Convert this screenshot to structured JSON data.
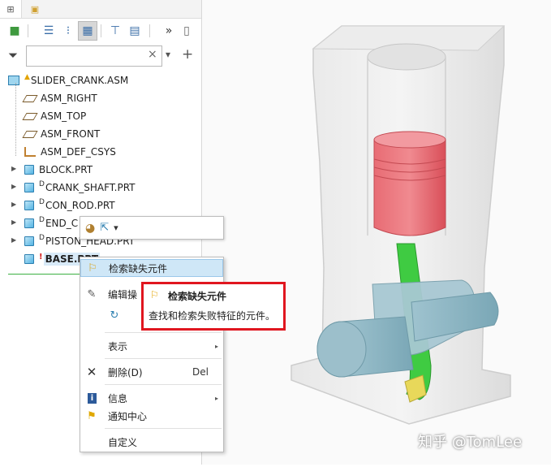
{
  "tabs": [
    {
      "icon": "model-tree-icon"
    },
    {
      "icon": "folder-browser-icon"
    }
  ],
  "toolbar": {
    "buttons": [
      "settings-icon",
      "tree-list-icon",
      "tree-filter-icon",
      "columns-icon",
      "show-icon",
      "layers-icon",
      "more-icon",
      "notes-icon"
    ]
  },
  "filter": {
    "value": "",
    "placeholder": "",
    "clear": "×",
    "dropdown": "▾",
    "add": "+"
  },
  "tree": {
    "items": [
      {
        "label": "SLIDER_CRANK.ASM",
        "icon": "assembly-icon",
        "mark": "▲"
      },
      {
        "label": "ASM_RIGHT",
        "icon": "datum-plane-icon"
      },
      {
        "label": "ASM_TOP",
        "icon": "datum-plane-icon"
      },
      {
        "label": "ASM_FRONT",
        "icon": "datum-plane-icon"
      },
      {
        "label": "ASM_DEF_CSYS",
        "icon": "csys-icon"
      },
      {
        "label": "BLOCK.PRT",
        "icon": "part-icon"
      },
      {
        "label": "CRANK_SHAFT.PRT",
        "icon": "part-icon",
        "mark": "D"
      },
      {
        "label": "CON_ROD.PRT",
        "icon": "part-icon",
        "mark": "D"
      },
      {
        "label": "END_C",
        "icon": "part-icon",
        "mark": "D"
      },
      {
        "label": "PISTON_HEAD.PRT",
        "icon": "part-icon",
        "mark": "D"
      },
      {
        "label": "BASE.PRT",
        "icon": "part-icon",
        "mark": "!"
      }
    ]
  },
  "minibar": {
    "icons": [
      "appearance-icon",
      "component-op-icon"
    ],
    "arrow": "▾"
  },
  "context_menu": {
    "items": [
      {
        "label": "检索缺失元件",
        "icon": "retrieve-icon",
        "hover": true
      },
      {
        "label": "编辑操",
        "icon": "pencil-icon"
      },
      {
        "label": "",
        "icon": "regen-icon"
      },
      {
        "label": "表示",
        "submenu": "▸"
      },
      {
        "label": "删除(D)",
        "shortcut": "Del",
        "icon": "close-icon"
      },
      {
        "label": "信息",
        "submenu": "▸",
        "icon": "info-icon"
      },
      {
        "label": "通知中心",
        "icon": "flag-icon"
      },
      {
        "label": "自定义"
      }
    ]
  },
  "tooltip": {
    "title": "检索缺失元件",
    "description": "查找和检索失败特征的元件。",
    "border_color": "#e0161f"
  },
  "watermark": "知乎 @TomLee",
  "colors": {
    "piston": "#e05a64",
    "rod": "#35c83a",
    "shaft": "#8fb8c8",
    "block": "#d8d8d8"
  }
}
